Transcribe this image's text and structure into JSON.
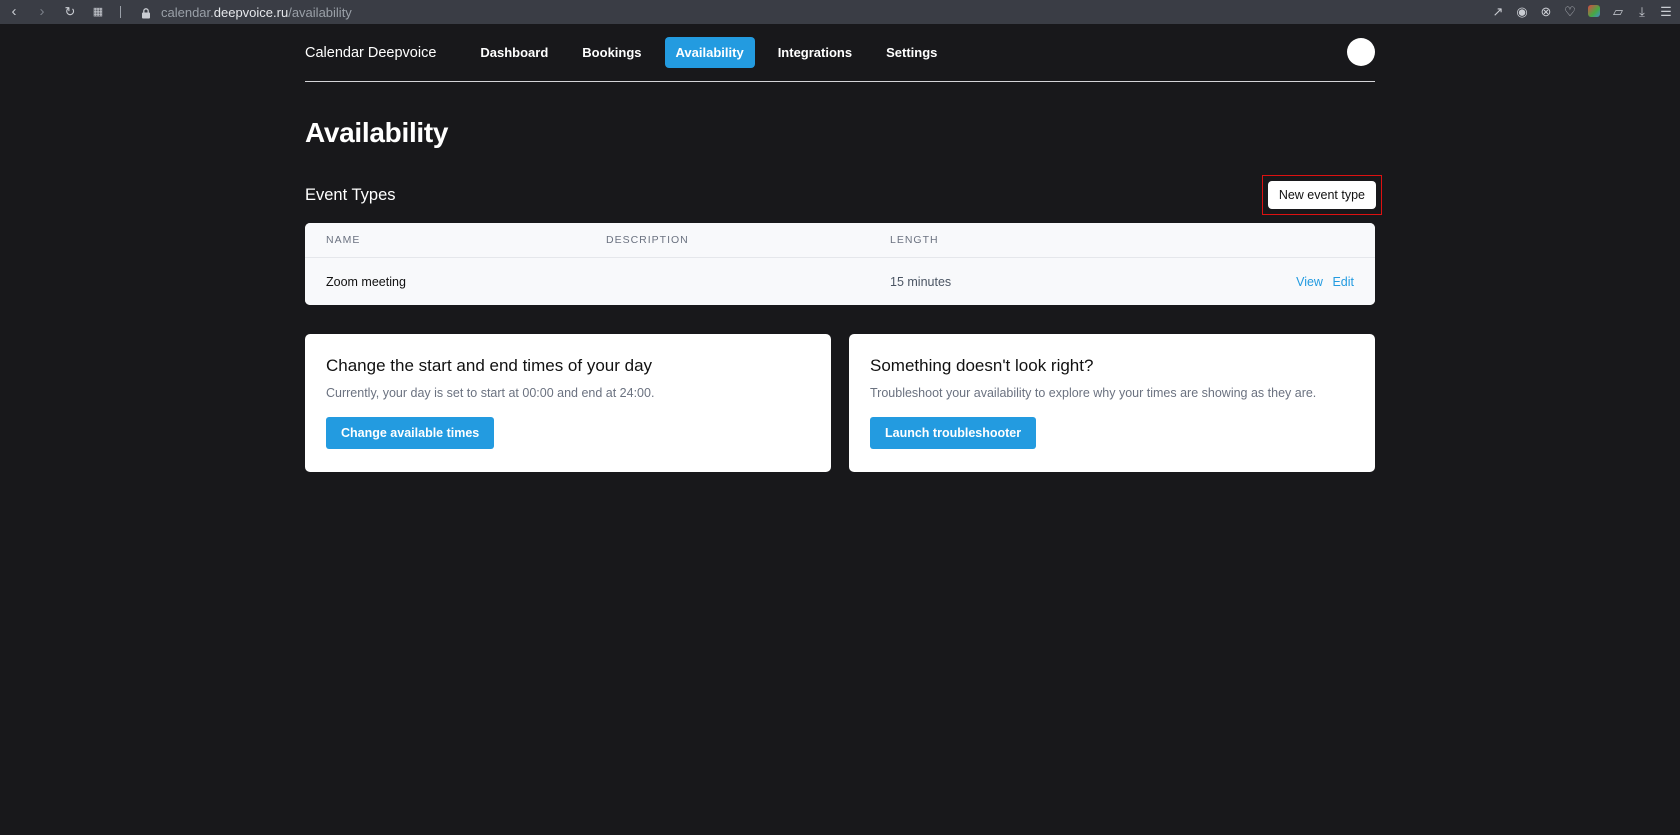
{
  "browser": {
    "url_prefix": "calendar.",
    "url_domain": "deepvoice.ru",
    "url_path": "/availability"
  },
  "nav": {
    "brand": "Calendar Deepvoice",
    "items": [
      "Dashboard",
      "Bookings",
      "Availability",
      "Integrations",
      "Settings"
    ],
    "active": "Availability"
  },
  "page": {
    "title": "Availability"
  },
  "event_types": {
    "title": "Event Types",
    "new_button": "New event type",
    "columns": [
      "NAME",
      "DESCRIPTION",
      "LENGTH"
    ],
    "rows": [
      {
        "name": "Zoom meeting",
        "description": "",
        "length": "15 minutes",
        "view": "View",
        "edit": "Edit"
      }
    ]
  },
  "cards": [
    {
      "title": "Change the start and end times of your day",
      "text": "Currently, your day is set to start at 00:00 and end at 24:00.",
      "button": "Change available times"
    },
    {
      "title": "Something doesn't look right?",
      "text": "Troubleshoot your availability to explore why your times are showing as they are.",
      "button": "Launch troubleshooter"
    }
  ],
  "colors": {
    "accent": "#239be0",
    "background": "#18181b",
    "highlight_frame": "#dd1111"
  }
}
